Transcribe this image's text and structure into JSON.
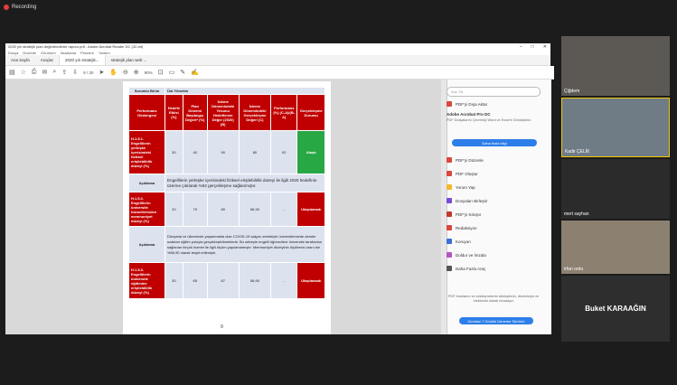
{
  "recording": {
    "label": "Recording"
  },
  "window": {
    "title": "2020 yılı stratejik plan değerlendirme raporu.pdf - Adobe Acrobat Reader DC (32-bit)",
    "menu": [
      "Dosya",
      "Düzenle",
      "Görünüm",
      "İmzalama",
      "Pencere",
      "Yardım"
    ],
    "tabs": [
      "Ana Sayfa",
      "Araçlar",
      "2020 yılı stratejik...",
      "stratejik plan web ..."
    ],
    "zoom": "90%",
    "page_indicator": "9 / 30",
    "controls": [
      "–",
      "□",
      "✕"
    ]
  },
  "table": {
    "unit_header": {
      "label": "Sorumlu Birim",
      "value": "Üst Yönetim"
    },
    "columns": [
      "Performans Göstergesi",
      "Hedefe Etkisi (%)",
      "Plan Dönemi Başlangıç Değeri* (%)",
      "İzleme Dönemindeki Yılsonu Hedeflenen Değer (2020) (B)",
      "İzleme Dönemindeki Gerçekleşme Değeri (C)",
      "Performans (%) (C-A)/(B-A)",
      "Gerçekleşme Durumu"
    ],
    "rows": [
      {
        "label": "H.1.5.1. Engellilerin yerleşke içerisindeki fiziksel erişilebilirlik düzeyi (%)",
        "values": [
          "30",
          "40",
          "90",
          "80",
          "92"
        ],
        "status": "Ulaştı",
        "status_color": "#28a745"
      },
      {
        "label": "H.1.5.2. Engellilerin üniversite hizmetlerinden memnuniyet düzeyi (%)",
        "values": [
          "20",
          "70",
          "80",
          "56,90",
          "-"
        ],
        "status": "Ulaşılamadı",
        "status_color": "#c00000"
      },
      {
        "label": "H.1.5.3. Engellilerin üniversite eğitimine erişilebilirlik düzeyi (%)",
        "values": [
          "30",
          "65",
          "67",
          "56,90",
          "-"
        ],
        "status": "Ulaşılamadı",
        "status_color": "#c00000"
      }
    ],
    "explanations": [
      {
        "label": "Açıklama",
        "text": "Engellilerin yerleşke içerisindeki fiziksel erişilebilirlik düzeyi ile ilgili 2020 hedefinin üzerine çıkılarak %92 gerçekleşme sağlanmıştır."
      },
      {
        "label": "Açıklama",
        "text": "Dünyada ve ülkemizde yaşanmakta olan COVID-19 salgını sebebiyle üniversitemizde dersler uzaktan eğitim yoluyla gerçekleştirilmektedir. Bu sebeple engelli öğrencilere üniversite tarafından sağlanan birçok hizmet ile ilgili ölçüm yapılamamıştır. Memnuniyet düzeyinin ölçülmesi oranı ise %56,90 olarak tespit edilmiştir."
      }
    ],
    "page_number": "9"
  },
  "right_panel": {
    "search_placeholder": "Ara: Gk",
    "export_label": "PDF'yi Dışa Aktar",
    "product_title": "Adobe Acrobat Pro DC",
    "product_desc": "PDF Dosyalarını Çevrimiçi Word ve Excel'e Dönüştürün",
    "more_button": "Daha fazla bilgi",
    "tools": [
      {
        "label": "PDF'yi Düzenle",
        "color": "#d8483d"
      },
      {
        "label": "PDF Oluştur",
        "color": "#d8483d"
      },
      {
        "label": "Yorum Yap",
        "color": "#f3b82c"
      },
      {
        "label": "Dosyaları Birleştir",
        "color": "#7a4bd6"
      },
      {
        "label": "PDF'yi Sıkıştır",
        "color": "#c0392b"
      },
      {
        "label": "Redaksiyon",
        "color": "#d8483d"
      },
      {
        "label": "Koruyun",
        "color": "#3a6fd8"
      },
      {
        "label": "Doldur ve İmzala",
        "color": "#b553c4"
      },
      {
        "label": "Daha Fazla Araç",
        "color": "#555555"
      }
    ],
    "promo_text": "PDF formlarını ve sözleşmelerini dönüştürün, düzenleyin ve elektronik olarak imzalayın",
    "promo_button": "Ücretsiz 7 Günlük Deneme Sürümü"
  },
  "participants": [
    {
      "name": "Çiğdem"
    },
    {
      "name": "Kadir ÇELİK"
    },
    {
      "name": "mert sayhan"
    },
    {
      "name": "irfan ordu"
    },
    {
      "name": "Buket KARAAĞIN"
    }
  ]
}
